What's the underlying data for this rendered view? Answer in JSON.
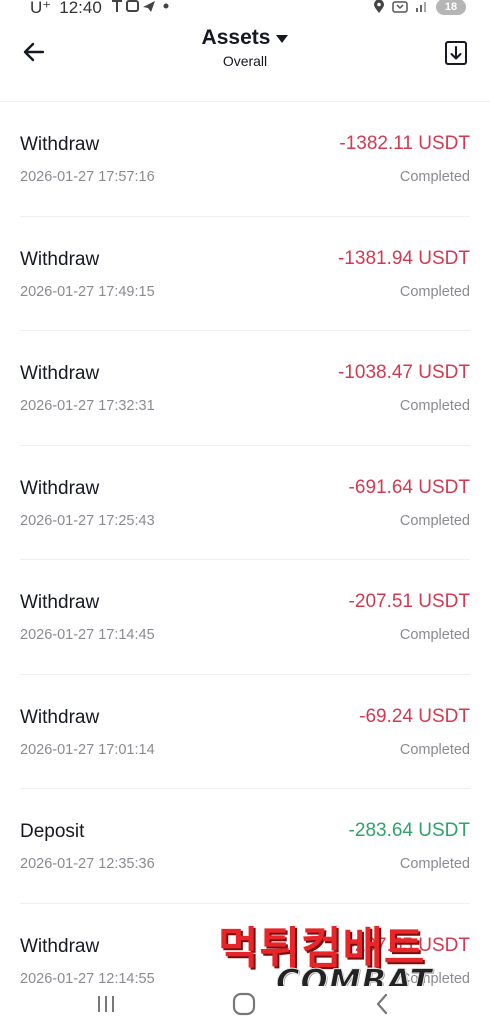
{
  "status_bar": {
    "carrier": "U⁺",
    "time": "12:40",
    "battery": "18"
  },
  "header": {
    "title": "Assets",
    "subtitle": "Overall"
  },
  "transactions": [
    {
      "type": "Withdraw",
      "datetime": "2026-01-27 17:57:16",
      "amount": "-1382.11 USDT",
      "status": "Completed",
      "direction": "out"
    },
    {
      "type": "Withdraw",
      "datetime": "2026-01-27 17:49:15",
      "amount": "-1381.94 USDT",
      "status": "Completed",
      "direction": "out"
    },
    {
      "type": "Withdraw",
      "datetime": "2026-01-27 17:32:31",
      "amount": "-1038.47 USDT",
      "status": "Completed",
      "direction": "out"
    },
    {
      "type": "Withdraw",
      "datetime": "2026-01-27 17:25:43",
      "amount": "-691.64 USDT",
      "status": "Completed",
      "direction": "out"
    },
    {
      "type": "Withdraw",
      "datetime": "2026-01-27 17:14:45",
      "amount": "-207.51 USDT",
      "status": "Completed",
      "direction": "out"
    },
    {
      "type": "Withdraw",
      "datetime": "2026-01-27 17:01:14",
      "amount": "-69.24 USDT",
      "status": "Completed",
      "direction": "out"
    },
    {
      "type": "Deposit",
      "datetime": "2026-01-27 12:35:36",
      "amount": "-283.64 USDT",
      "status": "Completed",
      "direction": "in"
    },
    {
      "type": "Withdraw",
      "datetime": "2026-01-27 12:14:55",
      "amount": "-207.55 USDT",
      "status": "Completed",
      "direction": "out"
    }
  ],
  "watermark": {
    "korean": "먹튀컴배트",
    "english": "COMBAT"
  },
  "colors": {
    "outgoing": "#d33a51",
    "incoming": "#2ea36b",
    "muted": "#8a8b91"
  },
  "icons": {
    "back": "arrow-left-icon",
    "dropdown": "caret-down-icon",
    "download": "download-icon",
    "nav_recent": "recent-apps-icon",
    "nav_home": "home-icon",
    "nav_back": "chevron-left-icon"
  }
}
